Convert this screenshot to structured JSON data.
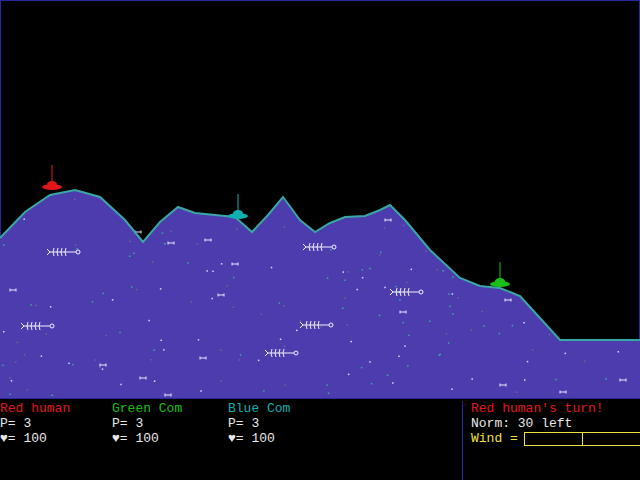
{
  "players": [
    {
      "name": "Red human",
      "power": "P= 3",
      "health": "♥= 100",
      "color": "#e01818"
    },
    {
      "name": "Green Com",
      "power": "P= 3",
      "health": "♥= 100",
      "color": "#18c018"
    },
    {
      "name": "Blue Com",
      "power": "P= 3",
      "health": "♥= 100",
      "color": "#10b0b0"
    }
  ],
  "turn": {
    "message": "Red human's turn!",
    "weapon": "Norm: 30 left",
    "color": "#e01818"
  },
  "wind": {
    "label": "Wind =",
    "level": 0.5
  }
}
